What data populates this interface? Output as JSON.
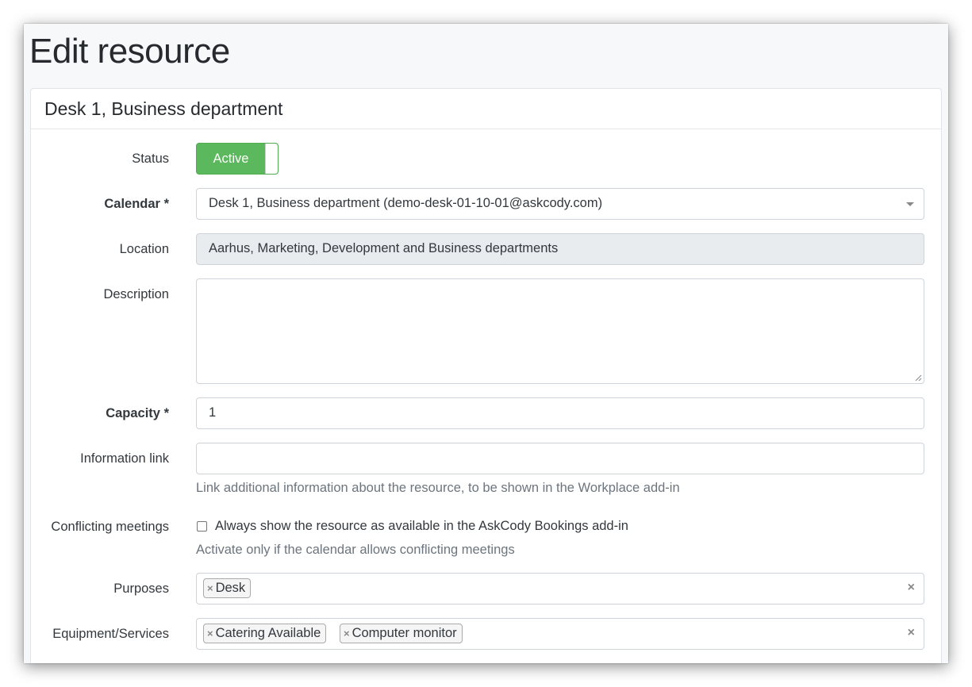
{
  "page": {
    "title": "Edit resource"
  },
  "card": {
    "header": "Desk 1, Business department"
  },
  "form": {
    "status": {
      "label": "Status",
      "toggle_label": "Active",
      "on": true
    },
    "calendar": {
      "label": "Calendar *",
      "value": "Desk 1, Business department (demo-desk-01-10-01@askcody.com)"
    },
    "location": {
      "label": "Location",
      "value": "Aarhus, Marketing, Development and Business departments"
    },
    "description": {
      "label": "Description",
      "value": ""
    },
    "capacity": {
      "label": "Capacity *",
      "value": "1"
    },
    "information_link": {
      "label": "Information link",
      "value": "",
      "help": "Link additional information about the resource, to be shown in the Workplace add-in"
    },
    "conflicting_meetings": {
      "label": "Conflicting meetings",
      "checkbox_label": "Always show the resource as available in the AskCody Bookings add-in",
      "checked": false,
      "help": "Activate only if the calendar allows conflicting meetings"
    },
    "purposes": {
      "label": "Purposes",
      "tags": [
        "Desk"
      ]
    },
    "equipment": {
      "label": "Equipment/Services",
      "tags": [
        "Catering Available",
        "Computer monitor"
      ]
    }
  },
  "icons": {
    "remove_tag": "×",
    "clear_all": "×"
  },
  "colors": {
    "active_toggle": "#5cb85c",
    "disabled_field": "#e9ecef"
  }
}
